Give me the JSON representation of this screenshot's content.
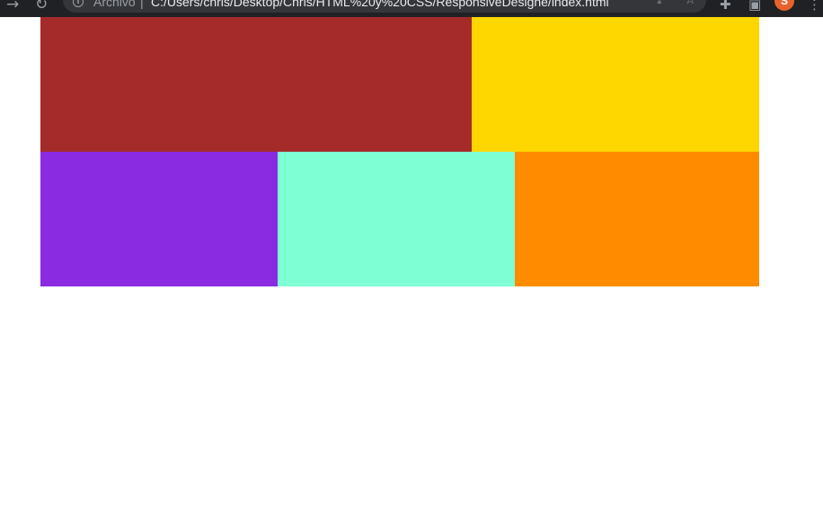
{
  "browser": {
    "omnibox": {
      "scheme_label": "Archivo",
      "separator": "|",
      "url": "C:/Users/chris/Desktop/Chris/HTML%20y%20CSS/ResponsiveDesigne/index.html"
    },
    "icons": [
      "forward-icon",
      "reload-icon",
      "info-icon",
      "share-icon",
      "bookmark-star-icon",
      "extensions-icon",
      "side-panel-icon",
      "profile-avatar",
      "menu-icon"
    ],
    "avatar_initial": "S",
    "avatar_color": "#e8622c"
  },
  "page": {
    "blocks": [
      {
        "name": "brown",
        "color": "#a52a2a"
      },
      {
        "name": "gold",
        "color": "#ffd700"
      },
      {
        "name": "blueviolet",
        "color": "#8a2be2"
      },
      {
        "name": "aquamarine",
        "color": "#7fffd4"
      },
      {
        "name": "darkorange",
        "color": "#ff8c00"
      }
    ]
  }
}
